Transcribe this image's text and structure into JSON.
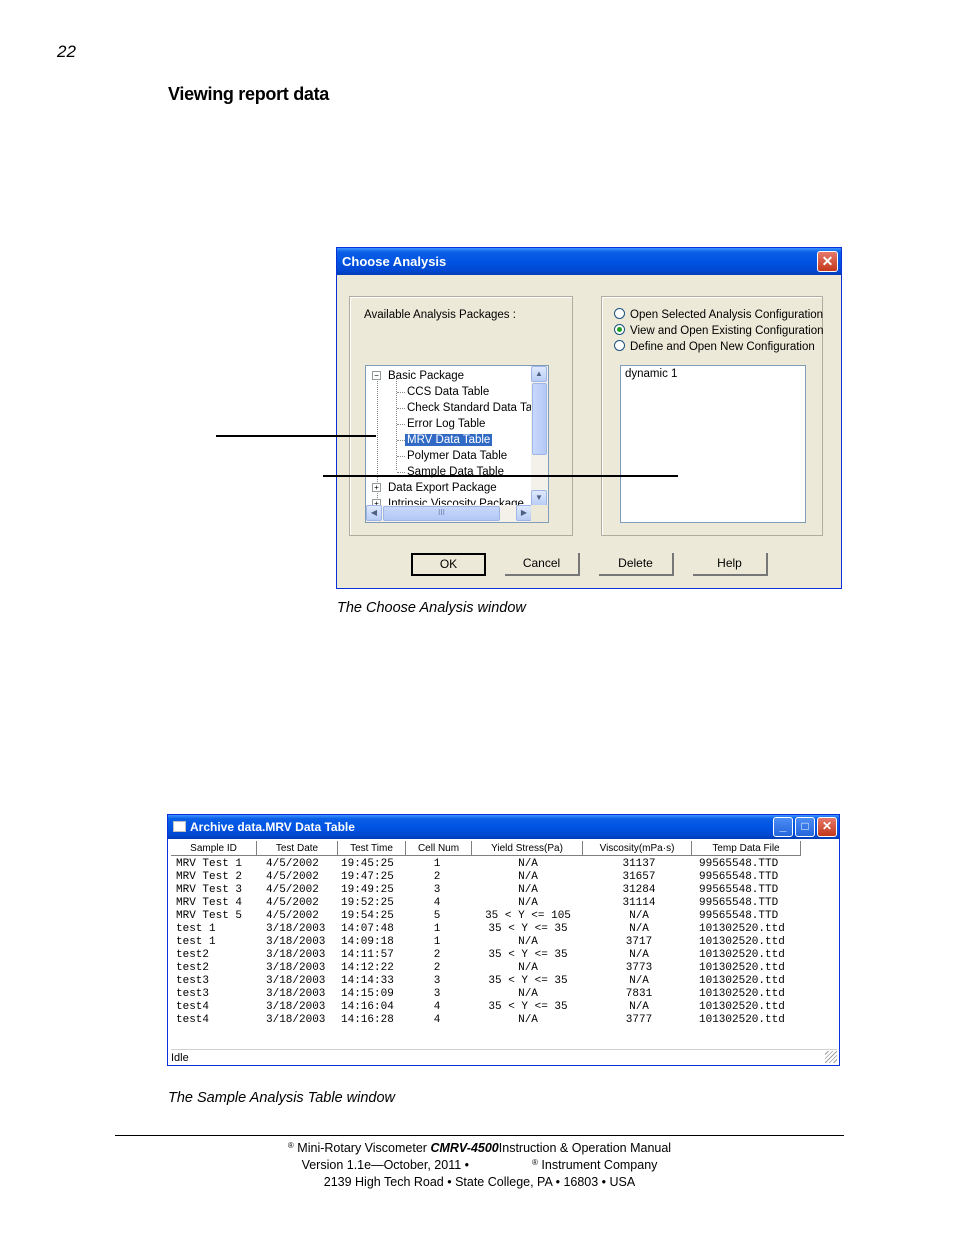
{
  "page": {
    "number": "22",
    "heading": "Viewing report data"
  },
  "choose_dialog": {
    "title": "Choose Analysis",
    "close_symbol": "✕",
    "available_label": "Available Analysis Packages :",
    "tree": {
      "basic": "Basic Package",
      "items": [
        "CCS Data Table",
        "Check Standard Data Tab",
        "Error Log Table",
        "MRV Data Table",
        "Polymer Data Table",
        "Sample Data Table"
      ],
      "data_export": "Data Export Package",
      "intrinsic": "Intrinsic Viscosity Package",
      "hscroll_grip": "III"
    },
    "radios": [
      {
        "label": "Open Selected Analysis Configuration",
        "checked": false
      },
      {
        "label": "View and Open Existing Configuration",
        "checked": true
      },
      {
        "label": "Define and Open New Configuration",
        "checked": false
      }
    ],
    "config_items": [
      "dynamic 1"
    ],
    "buttons": {
      "ok": "OK",
      "cancel": "Cancel",
      "delete": "Delete",
      "help": "Help"
    }
  },
  "caption1": "The Choose Analysis window",
  "archive_window": {
    "title": "Archive data.MRV Data Table",
    "min": "_",
    "max": "□",
    "close": "✕",
    "columns": [
      "Sample ID",
      "Test Date",
      "Test Time",
      "Cell Num",
      "Yield Stress(Pa)",
      "Viscosity(mPa·s)",
      "Temp Data File"
    ],
    "rows": [
      [
        "MRV Test 1",
        "4/5/2002",
        "19:45:25",
        "1",
        "N/A",
        "31137",
        "99565548.TTD"
      ],
      [
        "MRV Test 2",
        "4/5/2002",
        "19:47:25",
        "2",
        "N/A",
        "31657",
        "99565548.TTD"
      ],
      [
        "MRV Test 3",
        "4/5/2002",
        "19:49:25",
        "3",
        "N/A",
        "31284",
        "99565548.TTD"
      ],
      [
        "MRV Test 4",
        "4/5/2002",
        "19:52:25",
        "4",
        "N/A",
        "31114",
        "99565548.TTD"
      ],
      [
        "MRV Test 5",
        "4/5/2002",
        "19:54:25",
        "5",
        "35 < Y <= 105",
        "N/A",
        "99565548.TTD"
      ],
      [
        "test 1",
        "3/18/2003",
        "14:07:48",
        "1",
        "35 < Y <= 35",
        "N/A",
        "101302520.ttd"
      ],
      [
        "test 1",
        "3/18/2003",
        "14:09:18",
        "1",
        "N/A",
        "3717",
        "101302520.ttd"
      ],
      [
        "test2",
        "3/18/2003",
        "14:11:57",
        "2",
        "35 < Y <= 35",
        "N/A",
        "101302520.ttd"
      ],
      [
        "test2",
        "3/18/2003",
        "14:12:22",
        "2",
        "N/A",
        "3773",
        "101302520.ttd"
      ],
      [
        "test3",
        "3/18/2003",
        "14:14:33",
        "3",
        "35 < Y <= 35",
        "N/A",
        "101302520.ttd"
      ],
      [
        "test3",
        "3/18/2003",
        "14:15:09",
        "3",
        "N/A",
        "7831",
        "101302520.ttd"
      ],
      [
        "test4",
        "3/18/2003",
        "14:16:04",
        "4",
        "35 < Y <= 35",
        "N/A",
        "101302520.ttd"
      ],
      [
        "test4",
        "3/18/2003",
        "14:16:28",
        "4",
        "N/A",
        "3777",
        "101302520.ttd"
      ]
    ],
    "status": "Idle"
  },
  "caption2": "The Sample Analysis Table window",
  "footer": {
    "reg": "®",
    "line1_a": "Mini-Rotary Viscometer",
    "line1_brand": "CMRV-4500",
    "line1_b": "Instruction & Operation Manual",
    "line2_a": "Version 1.1e—October, 2011 •",
    "line2_b": "Instrument Company",
    "line3": "2139 High Tech Road • State College, PA • 16803 • USA"
  }
}
